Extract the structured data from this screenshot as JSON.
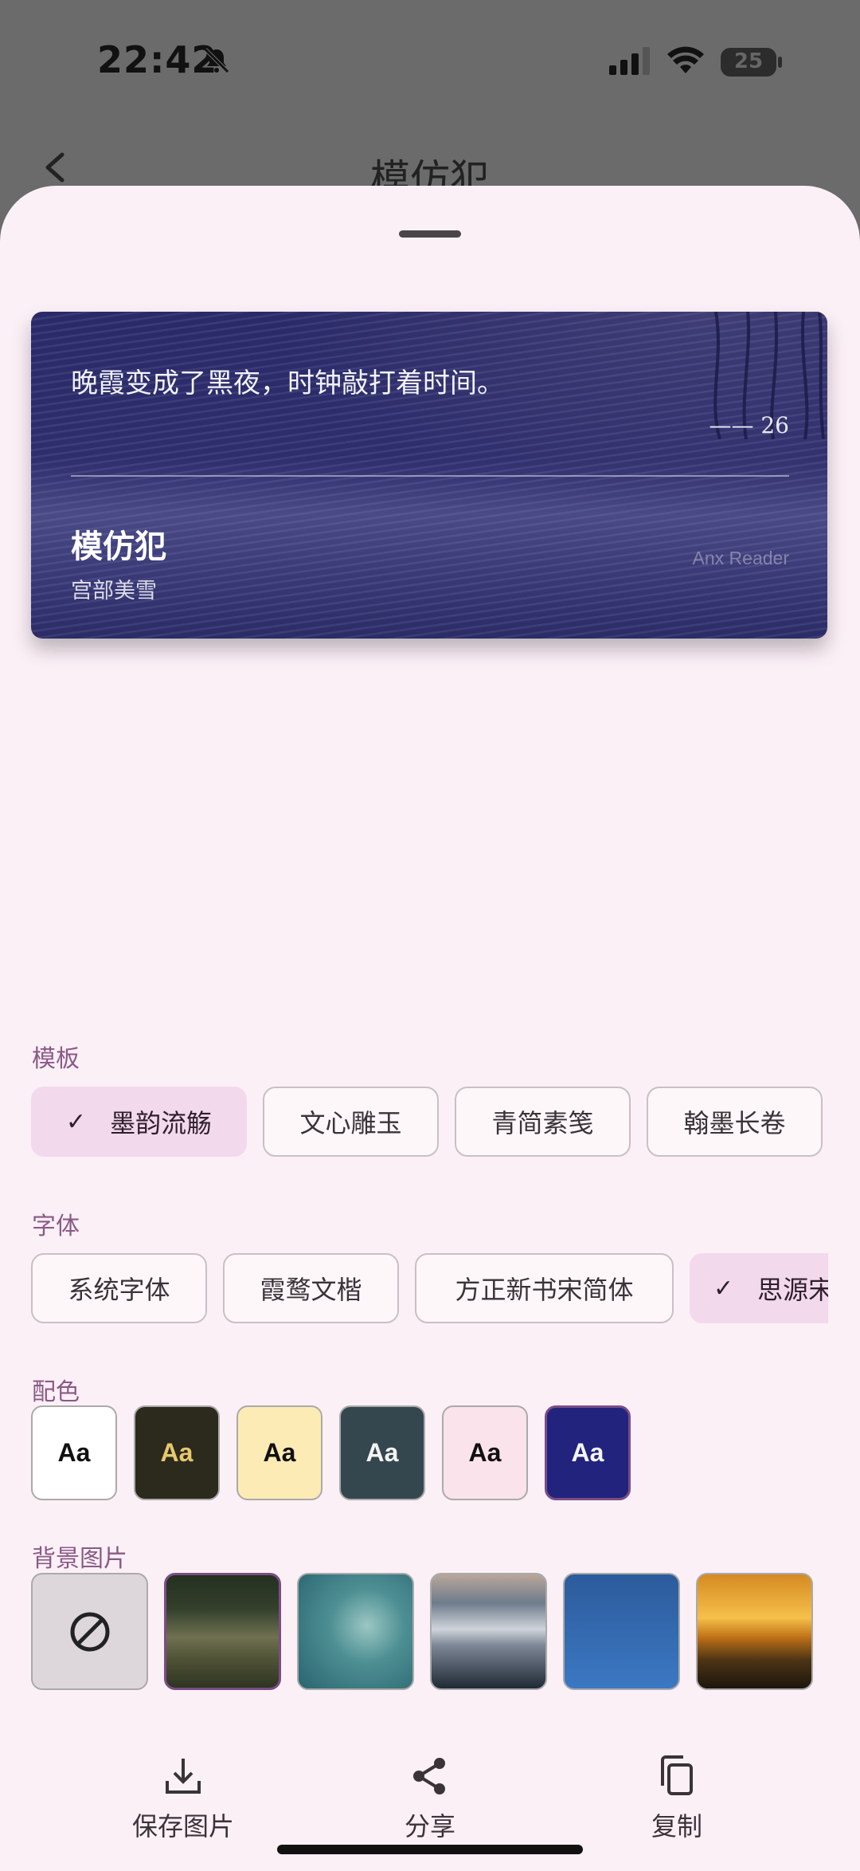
{
  "status_bar": {
    "time": "22:42",
    "battery": "25"
  },
  "behind": {
    "title": "模仿犯"
  },
  "card": {
    "quote": "晚霞变成了黑夜，时钟敲打着时间。",
    "page": "—— 26",
    "book_title": "模仿犯",
    "author": "宫部美雪",
    "brand": "Anx Reader"
  },
  "template": {
    "label": "模板",
    "options": [
      "墨韵流觞",
      "文心雕玉",
      "青简素笺",
      "翰墨长卷"
    ],
    "selected": "墨韵流觞"
  },
  "font": {
    "label": "字体",
    "options": [
      "系统字体",
      "霞鹜文楷",
      "方正新书宋简体",
      "思源宋"
    ],
    "selected": "思源宋"
  },
  "color": {
    "label": "配色",
    "swatch_text": "Aa",
    "swatches": [
      {
        "bg": "#ffffff",
        "fg": "#111111"
      },
      {
        "bg": "#2b2a1c",
        "fg": "#e7c86f"
      },
      {
        "bg": "#fcebb4",
        "fg": "#111111"
      },
      {
        "bg": "#34474f",
        "fg": "#f4f4f4"
      },
      {
        "bg": "#fae3ea",
        "fg": "#111111"
      },
      {
        "bg": "#21237d",
        "fg": "#f4f4f4",
        "selected": true
      }
    ]
  },
  "background": {
    "label": "背景图片",
    "items": [
      "none",
      "dark-forest-field",
      "teal-grass",
      "mountain-clouds",
      "blue-sky",
      "sunset-sea"
    ],
    "selected": "dark-forest-field"
  },
  "actions": {
    "save": "保存图片",
    "share": "分享",
    "copy": "复制"
  }
}
